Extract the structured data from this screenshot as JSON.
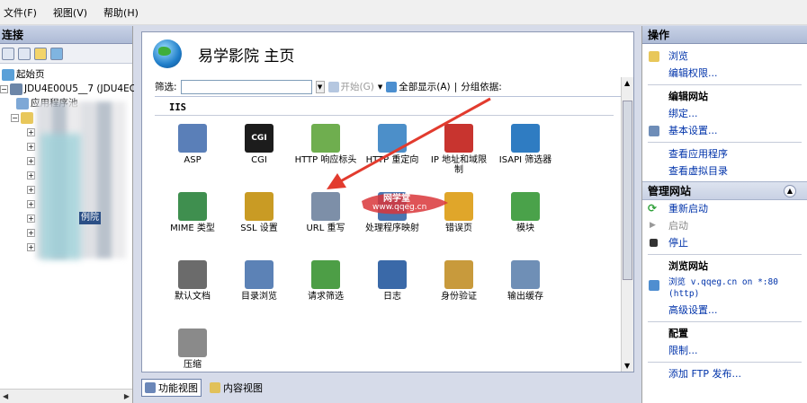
{
  "menu": [
    "文件(F)",
    "视图(V)",
    "帮助(H)"
  ],
  "connections": {
    "title": "连接",
    "tree": [
      {
        "label": "起始页",
        "indent": 0
      },
      {
        "label": "JDU4E00U5__7 (JDU4EO",
        "indent": 0
      },
      {
        "label": "应用程序池",
        "indent": 1
      },
      {
        "label": "",
        "indent": 1
      }
    ],
    "selected_fragment": "例院"
  },
  "page": {
    "title": "易学影院 主页",
    "filter_label": "筛选:",
    "filter_value": "",
    "start_label": "开始(G)",
    "show_all_label": "全部显示(A)",
    "group_label": "分组依据:",
    "section": "IIS",
    "features": [
      {
        "label": "ASP",
        "icon": "asp-icon",
        "color": "#5a7fb8"
      },
      {
        "label": "CGI",
        "icon": "cgi-icon",
        "color": "#1c1c1c"
      },
      {
        "label": "HTTP 响应标头",
        "icon": "http-headers-icon",
        "color": "#6fae4f"
      },
      {
        "label": "HTTP 重定向",
        "icon": "http-redirect-icon",
        "color": "#4c8fc9"
      },
      {
        "label": "IP 地址和域限制",
        "icon": "ip-restrictions-icon",
        "color": "#c8342f"
      },
      {
        "label": "ISAPI 筛选器",
        "icon": "isapi-filter-icon",
        "color": "#2f7cc2"
      },
      {
        "label": "MIME 类型",
        "icon": "mime-types-icon",
        "color": "#3f8f4f"
      },
      {
        "label": "SSL 设置",
        "icon": "ssl-lock-icon",
        "color": "#c99b24"
      },
      {
        "label": "URL 重写",
        "icon": "url-rewrite-icon",
        "color": "#7d8fa8"
      },
      {
        "label": "处理程序映射",
        "icon": "handler-mappings-icon",
        "color": "#4a76b0"
      },
      {
        "label": "错误页",
        "icon": "error-pages-icon",
        "color": "#e0a62a"
      },
      {
        "label": "模块",
        "icon": "modules-icon",
        "color": "#4aa24a"
      },
      {
        "label": "默认文档",
        "icon": "default-document-icon",
        "color": "#6b6b6b"
      },
      {
        "label": "目录浏览",
        "icon": "directory-browsing-icon",
        "color": "#5c82b6"
      },
      {
        "label": "请求筛选",
        "icon": "request-filtering-icon",
        "color": "#4d9e46"
      },
      {
        "label": "日志",
        "icon": "logging-icon",
        "color": "#3a69a8"
      },
      {
        "label": "身份验证",
        "icon": "authentication-icon",
        "color": "#c89a3c"
      },
      {
        "label": "输出缓存",
        "icon": "output-caching-icon",
        "color": "#6f8fb6"
      },
      {
        "label": "压缩",
        "icon": "compression-icon",
        "color": "#8a8a8a"
      }
    ],
    "view_tabs": [
      "功能视图",
      "内容视图"
    ],
    "watermark": {
      "brand": "网学堂",
      "url": "www.qqeg.cn"
    }
  },
  "actions": {
    "title": "操作",
    "group1": [
      {
        "label": "浏览",
        "icon": "explore-icon",
        "link": true
      },
      {
        "label": "编辑权限...",
        "icon": "",
        "link": true
      }
    ],
    "edit_site_head": "编辑网站",
    "group2": [
      {
        "label": "绑定...",
        "icon": "",
        "link": true
      },
      {
        "label": "基本设置...",
        "icon": "basic-settings-icon",
        "link": true
      }
    ],
    "group3": [
      {
        "label": "查看应用程序",
        "icon": "",
        "link": true
      },
      {
        "label": "查看虚拟目录",
        "icon": "",
        "link": true
      }
    ],
    "manage_title": "管理网站",
    "manage": [
      {
        "label": "重新启动",
        "icon": "restart-icon",
        "link": true
      },
      {
        "label": "启动",
        "icon": "start-icon",
        "link": false
      },
      {
        "label": "停止",
        "icon": "stop-icon",
        "link": true
      }
    ],
    "browse_head": "浏览网站",
    "browse_link_line1": "浏览 v.qqeg.cn on *:80",
    "browse_link_line2": "(http)",
    "advanced": "高级设置...",
    "config_head": "配置",
    "limits": "限制...",
    "ftp": "添加 FTP 发布..."
  }
}
